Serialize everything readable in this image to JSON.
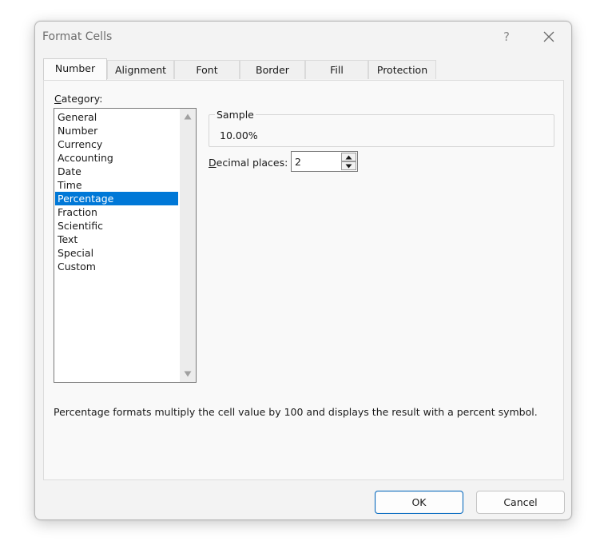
{
  "window": {
    "title": "Format Cells",
    "help": "?"
  },
  "tabs": [
    {
      "label": "Number",
      "active": true
    },
    {
      "label": "Alignment",
      "active": false
    },
    {
      "label": "Font",
      "active": false
    },
    {
      "label": "Border",
      "active": false
    },
    {
      "label": "Fill",
      "active": false
    },
    {
      "label": "Protection",
      "active": false
    }
  ],
  "category": {
    "label_prefix": "C",
    "label_rest": "ategory:",
    "items": [
      {
        "label": "General"
      },
      {
        "label": "Number"
      },
      {
        "label": "Currency"
      },
      {
        "label": "Accounting"
      },
      {
        "label": "Date"
      },
      {
        "label": "Time"
      },
      {
        "label": "Percentage",
        "selected": true
      },
      {
        "label": "Fraction"
      },
      {
        "label": "Scientific"
      },
      {
        "label": "Text"
      },
      {
        "label": "Special"
      },
      {
        "label": "Custom"
      }
    ]
  },
  "sample": {
    "legend": "Sample",
    "value": "10.00%"
  },
  "decimal_places": {
    "label_prefix": "D",
    "label_rest": "ecimal places:",
    "value": "2"
  },
  "description": "Percentage formats multiply the cell value by 100 and displays the result with a percent symbol.",
  "buttons": {
    "ok": "OK",
    "cancel": "Cancel"
  },
  "colors": {
    "accent": "#0078d7",
    "ok_border": "#0067c0"
  }
}
